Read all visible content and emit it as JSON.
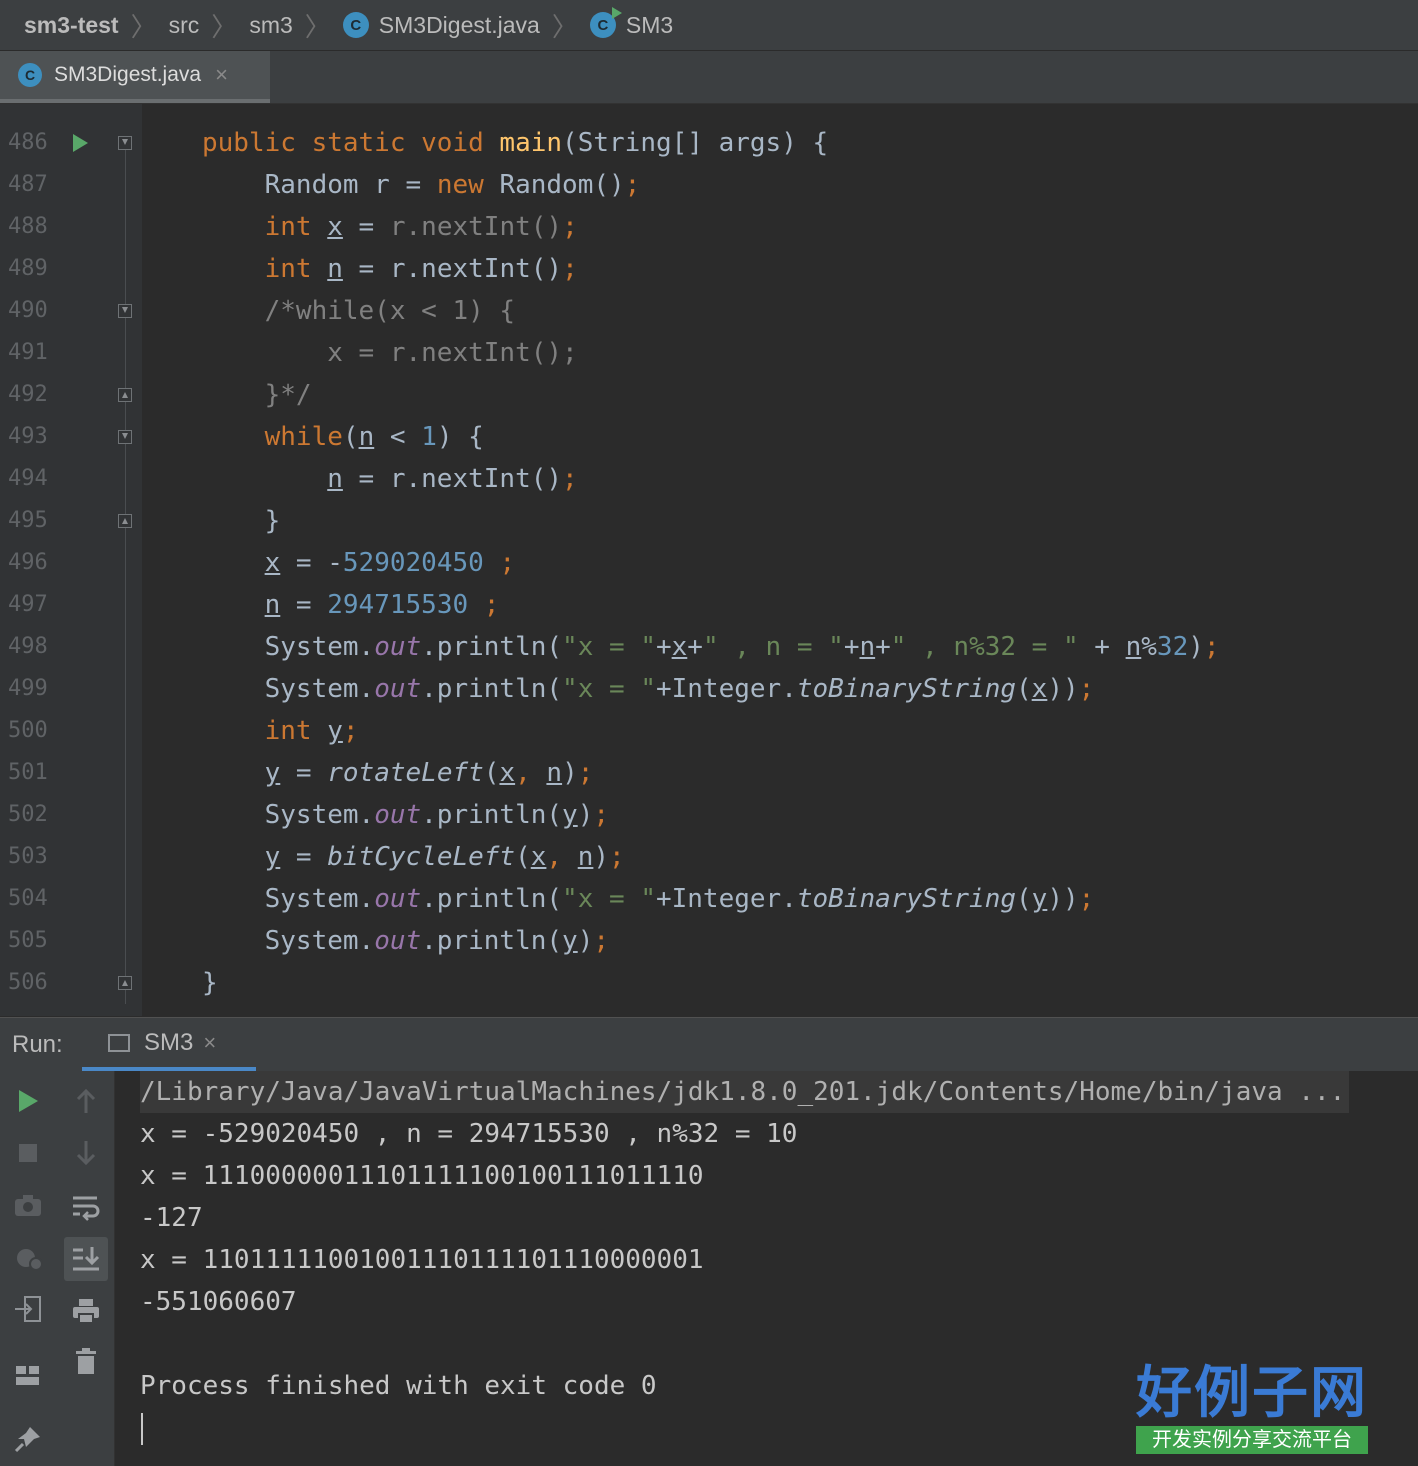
{
  "breadcrumb": {
    "project": "sm3-test",
    "folder1": "src",
    "folder2": "sm3",
    "file": "SM3Digest.java",
    "symbol": "SM3",
    "file_icon": "class-icon",
    "symbol_icon": "runnable-class-icon"
  },
  "editor_tab": {
    "label": "SM3Digest.java",
    "close": "×"
  },
  "line_numbers": [
    "486",
    "487",
    "488",
    "489",
    "490",
    "491",
    "492",
    "493",
    "494",
    "495",
    "496",
    "497",
    "498",
    "499",
    "500",
    "501",
    "502",
    "503",
    "504",
    "505",
    "506"
  ],
  "code_lines": [
    "public static void main(String[] args) {",
    "    Random r = new Random();",
    "    int x = r.nextInt();",
    "    int n = r.nextInt();",
    "    /*while(x < 1) {",
    "        x = r.nextInt();",
    "    }*/",
    "    while(n < 1) {",
    "        n = r.nextInt();",
    "    }",
    "    x = -529020450 ;",
    "    n = 294715530 ;",
    "    System.out.println(\"x = \"+x+\" , n = \"+n+\" , n%32 = \" + n%32);",
    "    System.out.println(\"x = \"+Integer.toBinaryString(x));",
    "    int y;",
    "    y = rotateLeft(x, n);",
    "    System.out.println(y);",
    "    y = bitCycleLeft(x, n);",
    "    System.out.println(\"x = \"+Integer.toBinaryString(y));",
    "    System.out.println(y);",
    "}"
  ],
  "run_panel": {
    "label": "Run:",
    "tab": "SM3",
    "tab_close": "×"
  },
  "console": {
    "command": "/Library/Java/JavaVirtualMachines/jdk1.8.0_201.jdk/Contents/Home/bin/java ...",
    "lines": [
      "x = -529020450 , n = 294715530 , n%32 = 10",
      "x = 11100000011101111100100111011110",
      "-127",
      "x = 11011111001001110111101110000001",
      "-551060607",
      "",
      "Process finished with exit code 0"
    ]
  },
  "watermark": {
    "title": "好例子网",
    "subtitle": "开发实例分享交流平台"
  },
  "colors": {
    "keyword": "#cc7832",
    "function": "#ffc66d",
    "number": "#6897bb",
    "string": "#6a8759",
    "field": "#9876aa",
    "default": "#a9b7c6"
  }
}
